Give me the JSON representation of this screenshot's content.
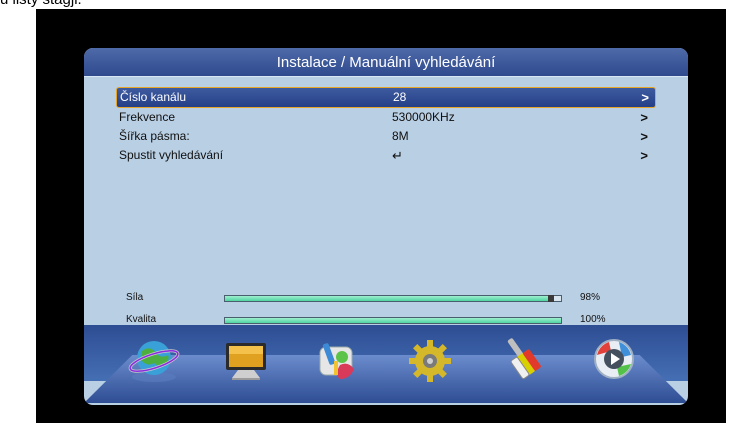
{
  "top_caption": "u listy stagji.",
  "title": "Instalace / Manuální vyhledávání",
  "rows": [
    {
      "label": "Číslo kanálu",
      "value": "28",
      "arrow": ">"
    },
    {
      "label": "Frekvence",
      "value": "530000KHz",
      "arrow": ">"
    },
    {
      "label": "Šířka pásma:",
      "value": "8M",
      "arrow": ">"
    },
    {
      "label": "Spustit vyhledávání",
      "value": "↵",
      "arrow": ">"
    }
  ],
  "meters": [
    {
      "label": "Síla",
      "percent_text": "98%",
      "level": 0.98
    },
    {
      "label": "Kvalita",
      "percent_text": "100%",
      "level": 1.0
    }
  ],
  "dock": [
    {
      "icon": "globe-satellite-icon"
    },
    {
      "icon": "tv-monitor-icon"
    },
    {
      "icon": "tools-icon"
    },
    {
      "icon": "gear-settings-icon"
    },
    {
      "icon": "av-cables-icon"
    },
    {
      "icon": "media-play-icon"
    }
  ],
  "colors": {
    "panel": "#b9cfe4",
    "title_bar": "#2f4a8e",
    "selection_border": "#e7a629",
    "meter_fill": "#4fd3a2"
  }
}
